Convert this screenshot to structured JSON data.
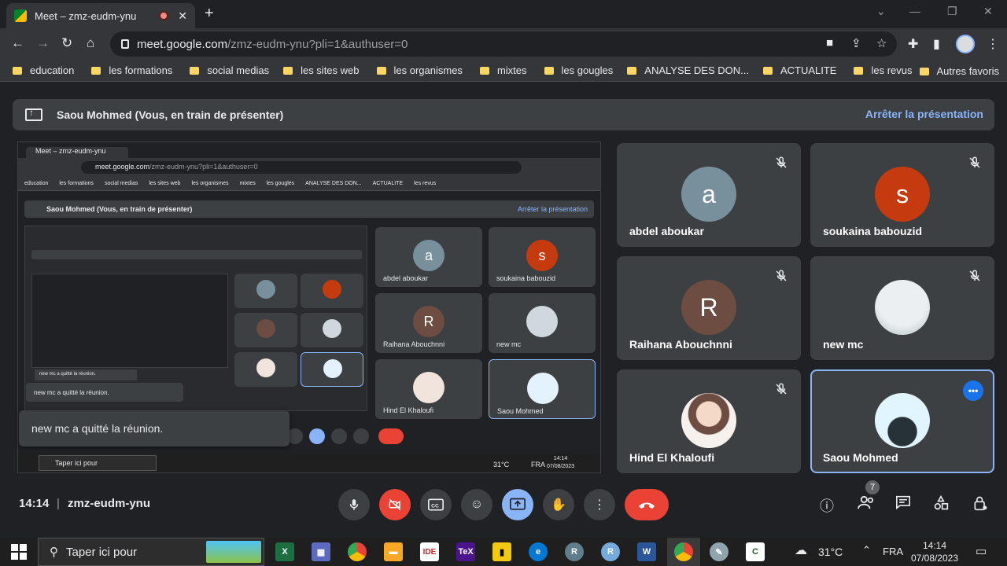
{
  "browser": {
    "tab_title": "Meet – zmz-eudm-ynu",
    "url_host": "meet.google.com",
    "url_path": "/zmz-eudm-ynu?pli=1&authuser=0",
    "bookmarks": [
      "education",
      "les formations",
      "social medias",
      "les sites web",
      "les organismes",
      "mixtes",
      "les gougles",
      "ANALYSE DES DON...",
      "ACTUALITE",
      "les revus"
    ],
    "other_bookmarks": "Autres favoris"
  },
  "presenting": {
    "text": "Saou Mohmed (Vous, en train de présenter)",
    "stop_label": "Arrêter la présentation"
  },
  "participants": [
    {
      "name": "abdel aboukar",
      "initial": "a",
      "color": "#78909c",
      "muted": true
    },
    {
      "name": "soukaina babouzid",
      "initial": "s",
      "color": "#c53b0f",
      "muted": true
    },
    {
      "name": "Raihana Abouchnni",
      "initial": "R",
      "color": "#6d4c41",
      "muted": true
    },
    {
      "name": "new mc",
      "initial": "",
      "color": "#cfd8dc",
      "muted": true
    },
    {
      "name": "Hind El Khaloufi",
      "initial": "",
      "color": "#f1e4dc",
      "muted": true
    },
    {
      "name": "Saou Mohmed",
      "initial": "",
      "color": "#e3f2fd",
      "muted": false
    }
  ],
  "toast": "new mc a quitté la réunion.",
  "nested": {
    "toast": "new mc a quitté la réunion.",
    "inner_toast": "new mc a quitté la réunion.",
    "taskbar_search": "Taper ici pour",
    "temp": "31°C",
    "lang": "FRA",
    "time": "14:14",
    "date": "07/08/2023"
  },
  "bottom_bar": {
    "time": "14:14",
    "separator": "|",
    "meeting_code": "zmz-eudm-ynu",
    "participant_count": "7"
  },
  "taskbar": {
    "search_placeholder": "Taper ici pour",
    "temperature": "31°C",
    "language": "FRA",
    "time": "14:14",
    "date": "07/08/2023"
  },
  "colors": {
    "accent_blue": "#8ab4f8",
    "end_call_red": "#ea4335",
    "tile_bg": "#3c4043"
  }
}
